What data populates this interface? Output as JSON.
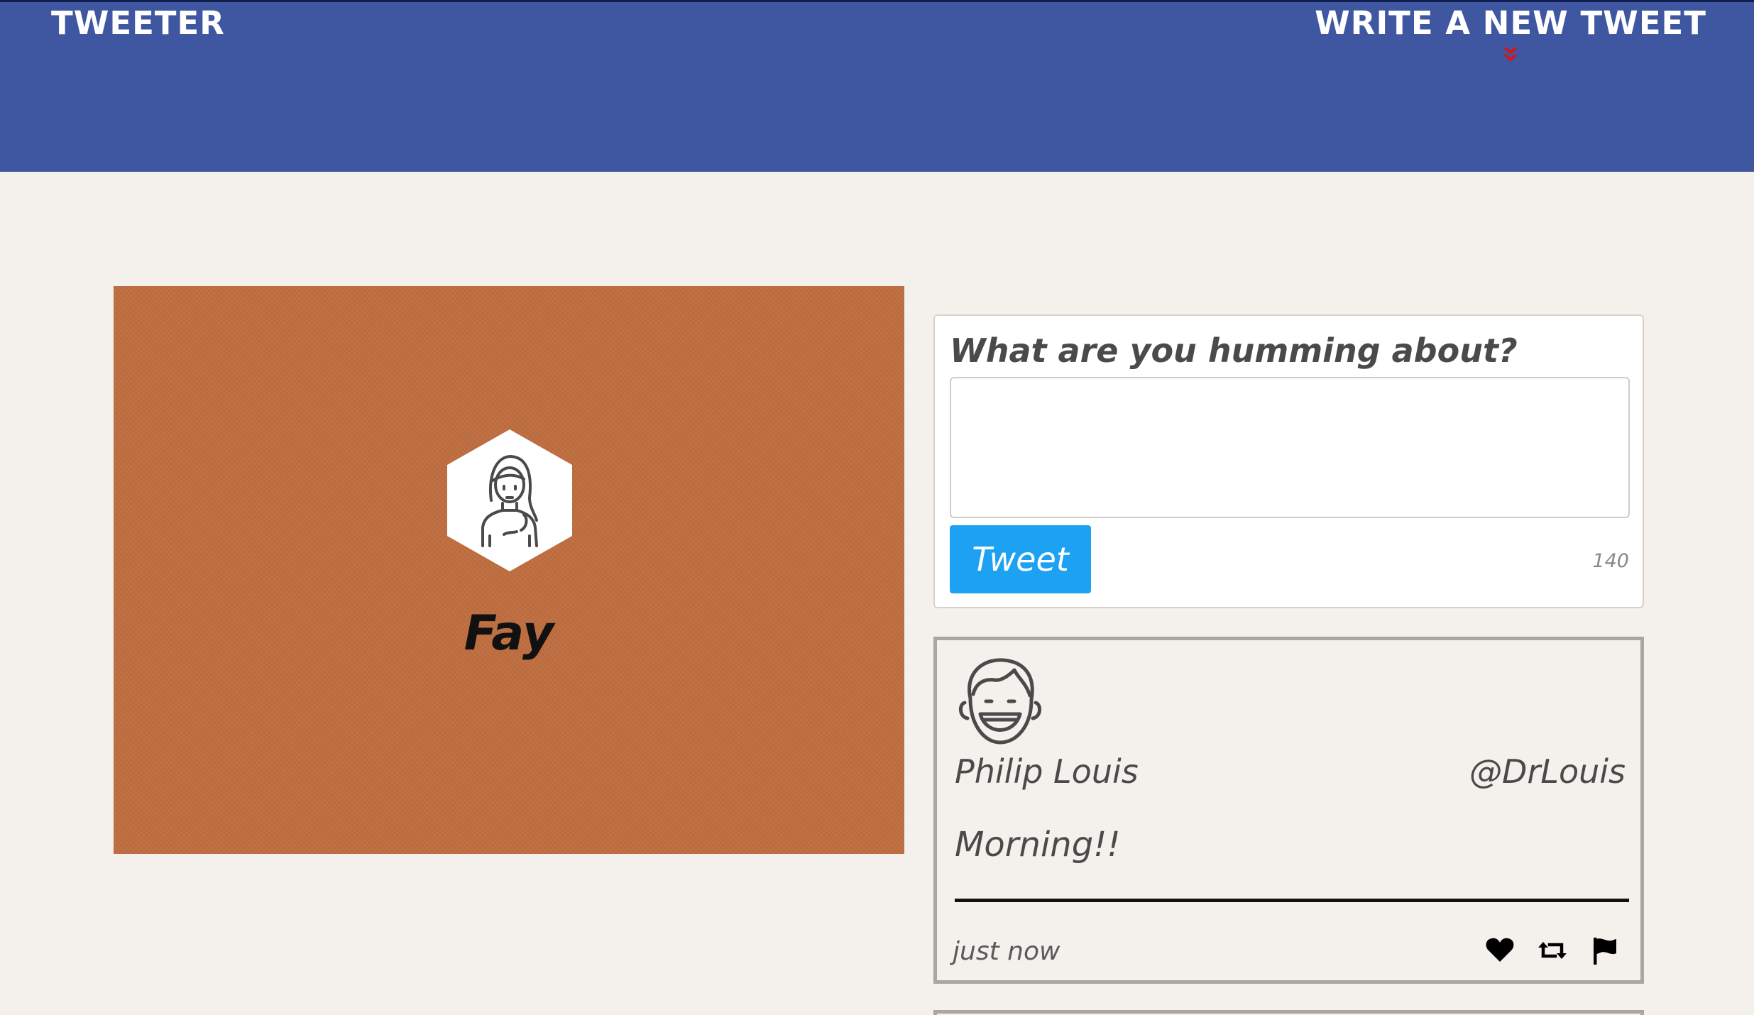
{
  "nav": {
    "brand": "TWEETER",
    "compose_label": "WRITE A NEW TWEET"
  },
  "profile": {
    "name": "Fay"
  },
  "composer": {
    "prompt": "What are you humming about?",
    "text_value": "",
    "button_label": "Tweet",
    "counter": "140"
  },
  "tweet": {
    "author": "Philip Louis",
    "handle": "@DrLouis",
    "content": "Morning!!",
    "time": "just now",
    "actions": [
      "heart-icon",
      "retweet-icon",
      "flag-icon"
    ]
  },
  "colors": {
    "nav_background": "#3f56a0",
    "profile_background": "#bf6e40",
    "page_background": "#f4f1ec",
    "tweet_button": "#1da1f2",
    "chevron_accent": "#d0181b"
  }
}
